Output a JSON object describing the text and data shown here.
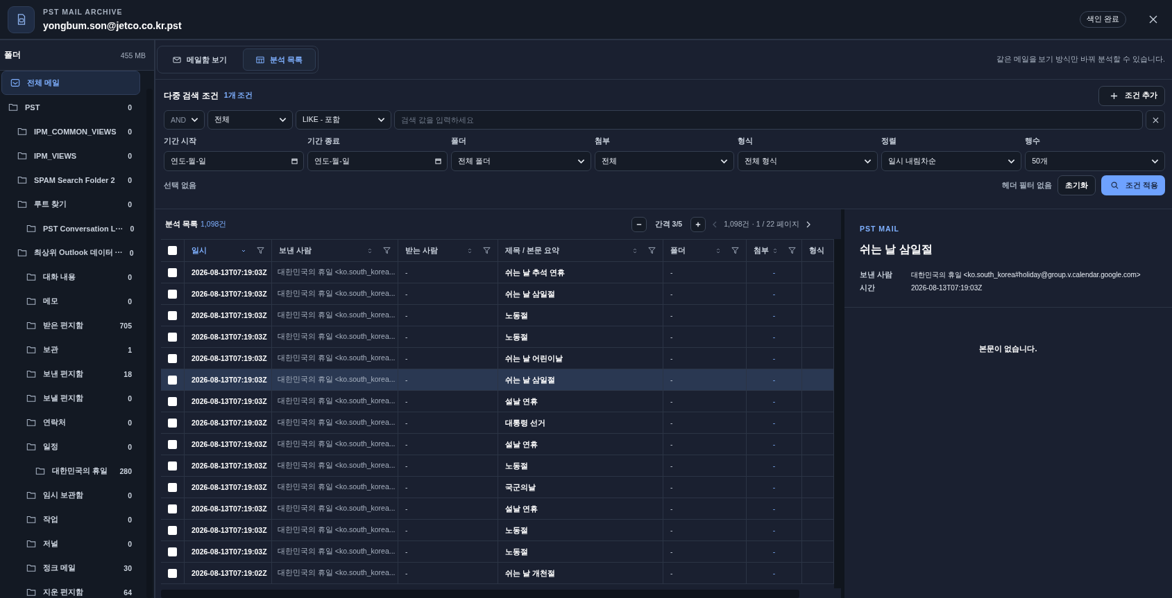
{
  "app": {
    "subtitle": "PST MAIL ARCHIVE",
    "title": "yongbum.son@jetco.co.kr.pst",
    "status": "색인 완료"
  },
  "sidebar": {
    "title": "폴더",
    "size": "455 MB",
    "items": [
      {
        "label": "전체 메일",
        "kind": "all",
        "selected": true
      },
      {
        "label": "PST",
        "kind": "folder",
        "selected": false,
        "count": "0",
        "children": [
          {
            "label": "IPM_COMMON_VIEWS",
            "kind": "folder",
            "selected": false,
            "count": "0"
          },
          {
            "label": "IPM_VIEWS",
            "kind": "folder",
            "selected": false,
            "count": "0"
          },
          {
            "label": "SPAM Search Folder 2",
            "kind": "folder",
            "selected": false,
            "count": "0"
          },
          {
            "label": "루트 찾기",
            "kind": "folder",
            "selected": false,
            "count": "0",
            "children": [
              {
                "label": "PST Conversation L···",
                "kind": "folder",
                "selected": false,
                "count": "0"
              }
            ]
          },
          {
            "label": "최상위 Outlook 데이터 ···",
            "kind": "folder",
            "selected": false,
            "count": "0",
            "children": [
              {
                "label": "대화 내용",
                "kind": "folder",
                "selected": false,
                "count": "0"
              },
              {
                "label": "메모",
                "kind": "folder",
                "selected": false,
                "count": "0"
              },
              {
                "label": "받은 편지함",
                "kind": "folder",
                "selected": false,
                "count": "705"
              },
              {
                "label": "보관",
                "kind": "folder",
                "selected": false,
                "count": "1"
              },
              {
                "label": "보낸 편지함",
                "kind": "folder",
                "selected": false,
                "count": "18"
              },
              {
                "label": "보낼 편지함",
                "kind": "folder",
                "selected": false,
                "count": "0"
              },
              {
                "label": "연락처",
                "kind": "folder",
                "selected": false,
                "count": "0"
              },
              {
                "label": "일정",
                "kind": "folder",
                "selected": false,
                "count": "0",
                "children": [
                  {
                    "label": "대한민국의 휴일",
                    "kind": "folder",
                    "selected": false,
                    "count": "280"
                  }
                ]
              },
              {
                "label": "임시 보관함",
                "kind": "folder",
                "selected": false,
                "count": "0"
              },
              {
                "label": "작업",
                "kind": "folder",
                "selected": false,
                "count": "0"
              },
              {
                "label": "저널",
                "kind": "folder",
                "selected": false,
                "count": "0"
              },
              {
                "label": "정크 메일",
                "kind": "folder",
                "selected": false,
                "count": "30"
              },
              {
                "label": "지운 편지함",
                "kind": "folder",
                "selected": false,
                "count": "64"
              }
            ]
          }
        ]
      }
    ]
  },
  "view_tabs": [
    {
      "label": "메일함 보기",
      "kind": "mail",
      "selected": false
    },
    {
      "label": "분석 목록",
      "kind": "table",
      "selected": true
    }
  ],
  "view_hint": "같은 메일을 보기 방식만 바꿔 분석할 수 있습니다.",
  "search": {
    "title": "다중 검색 조건",
    "condition_count": "1개 조건",
    "add_button": "조건 추가",
    "condition": {
      "operator": "AND",
      "field": "전체",
      "match": "LIKE - 포함",
      "placeholder": "검색 값을 입력하세요"
    },
    "filters": [
      {
        "label": "기간 시작",
        "kind": "date",
        "value": "연도-월-일"
      },
      {
        "label": "기간 종료",
        "kind": "date",
        "value": "연도-월-일"
      },
      {
        "label": "폴더",
        "kind": "select",
        "value": "전체 폴더"
      },
      {
        "label": "첨부",
        "kind": "select",
        "value": "전체"
      },
      {
        "label": "형식",
        "kind": "select",
        "value": "전체 형식"
      },
      {
        "label": "정렬",
        "kind": "select",
        "value": "일시 내림차순"
      },
      {
        "label": "행수",
        "kind": "select",
        "value": "50개"
      }
    ],
    "selection": "선택 없음",
    "header_filter": "헤더 필터 없음",
    "reset_button": "초기화",
    "apply_button": "조건 적용"
  },
  "table": {
    "title": "분석 목록",
    "total": "1,098건",
    "density": "간격 3/5",
    "pagination": "1,098건 · 1 / 22 페이지",
    "prev_disabled": true,
    "next_disabled": false,
    "all_checked": false,
    "columns": [
      {
        "label": "일시",
        "sorted": true
      },
      {
        "label": "보낸 사람",
        "sorted": false
      },
      {
        "label": "받는 사람",
        "sorted": false
      },
      {
        "label": "제목 / 본문 요약",
        "sorted": false
      },
      {
        "label": "폴더",
        "sorted": false
      },
      {
        "label": "첨부",
        "sorted": false
      },
      {
        "label": "형식",
        "sorted": false
      }
    ],
    "rows": [
      {
        "date": "2026-08-13T07:19:03Z",
        "sender": "대한민국의 휴일 <ko.south_korea...",
        "to": "-",
        "subject": "쉬는 날 추석 연휴",
        "folder": "-",
        "attach": "-",
        "selected": false,
        "checked": false
      },
      {
        "date": "2026-08-13T07:19:03Z",
        "sender": "대한민국의 휴일 <ko.south_korea...",
        "to": "-",
        "subject": "쉬는 날 삼일절",
        "folder": "-",
        "attach": "-",
        "selected": false,
        "checked": false
      },
      {
        "date": "2026-08-13T07:19:03Z",
        "sender": "대한민국의 휴일 <ko.south_korea...",
        "to": "-",
        "subject": "노동절",
        "folder": "-",
        "attach": "-",
        "selected": false,
        "checked": false
      },
      {
        "date": "2026-08-13T07:19:03Z",
        "sender": "대한민국의 휴일 <ko.south_korea...",
        "to": "-",
        "subject": "노동절",
        "folder": "-",
        "attach": "-",
        "selected": false,
        "checked": false
      },
      {
        "date": "2026-08-13T07:19:03Z",
        "sender": "대한민국의 휴일 <ko.south_korea...",
        "to": "-",
        "subject": "쉬는 날 어린이날",
        "folder": "-",
        "attach": "-",
        "selected": false,
        "checked": false
      },
      {
        "date": "2026-08-13T07:19:03Z",
        "sender": "대한민국의 휴일 <ko.south_korea...",
        "to": "-",
        "subject": "쉬는 날 삼일절",
        "folder": "-",
        "attach": "-",
        "selected": true,
        "checked": false
      },
      {
        "date": "2026-08-13T07:19:03Z",
        "sender": "대한민국의 휴일 <ko.south_korea...",
        "to": "-",
        "subject": "설날 연휴",
        "folder": "-",
        "attach": "-",
        "selected": false,
        "checked": false
      },
      {
        "date": "2026-08-13T07:19:03Z",
        "sender": "대한민국의 휴일 <ko.south_korea...",
        "to": "-",
        "subject": "대통령 선거",
        "folder": "-",
        "attach": "-",
        "selected": false,
        "checked": false
      },
      {
        "date": "2026-08-13T07:19:03Z",
        "sender": "대한민국의 휴일 <ko.south_korea...",
        "to": "-",
        "subject": "설날 연휴",
        "folder": "-",
        "attach": "-",
        "selected": false,
        "checked": false
      },
      {
        "date": "2026-08-13T07:19:03Z",
        "sender": "대한민국의 휴일 <ko.south_korea...",
        "to": "-",
        "subject": "노동절",
        "folder": "-",
        "attach": "-",
        "selected": false,
        "checked": false
      },
      {
        "date": "2026-08-13T07:19:03Z",
        "sender": "대한민국의 휴일 <ko.south_korea...",
        "to": "-",
        "subject": "국군의날",
        "folder": "-",
        "attach": "-",
        "selected": false,
        "checked": false
      },
      {
        "date": "2026-08-13T07:19:03Z",
        "sender": "대한민국의 휴일 <ko.south_korea...",
        "to": "-",
        "subject": "설날 연휴",
        "folder": "-",
        "attach": "-",
        "selected": false,
        "checked": false
      },
      {
        "date": "2026-08-13T07:19:03Z",
        "sender": "대한민국의 휴일 <ko.south_korea...",
        "to": "-",
        "subject": "노동절",
        "folder": "-",
        "attach": "-",
        "selected": false,
        "checked": false
      },
      {
        "date": "2026-08-13T07:19:03Z",
        "sender": "대한민국의 휴일 <ko.south_korea...",
        "to": "-",
        "subject": "노동절",
        "folder": "-",
        "attach": "-",
        "selected": false,
        "checked": false
      },
      {
        "date": "2026-08-13T07:19:02Z",
        "sender": "대한민국의 휴일 <ko.south_korea...",
        "to": "-",
        "subject": "쉬는 날 개천절",
        "folder": "-",
        "attach": "-",
        "selected": false,
        "checked": false
      }
    ]
  },
  "detail": {
    "eyebrow": "PST MAIL",
    "title": "쉬는 날 삼일절",
    "fields": [
      {
        "label": "보낸 사람",
        "value": "대한민국의 휴일 <ko.south_korea#holiday@group.v.calendar.google.com>"
      },
      {
        "label": "시간",
        "value": "2026-08-13T07:19:03Z"
      }
    ],
    "empty": "본문이 없습니다."
  }
}
